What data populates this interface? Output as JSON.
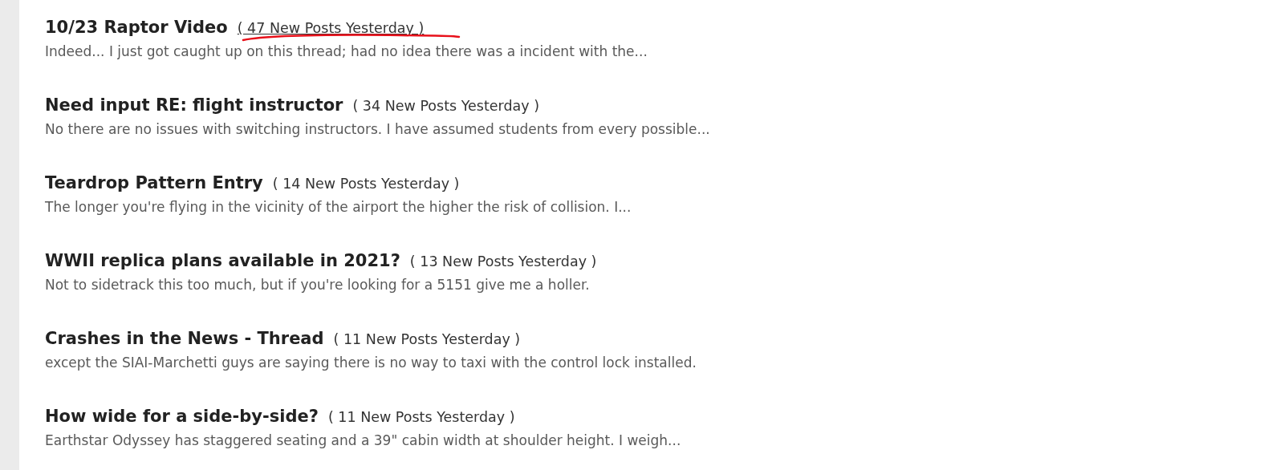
{
  "threads": [
    {
      "title": "10/23 Raptor Video",
      "count": "( 47 New Posts Yesterday )",
      "underlined": true,
      "annotated": true,
      "excerpt": "Indeed... I just got caught up on this thread; had no idea there was a incident with the..."
    },
    {
      "title": "Need input RE: flight instructor",
      "count": "( 34 New Posts Yesterday )",
      "underlined": false,
      "annotated": false,
      "excerpt": "No there are no issues with switching instructors. I have assumed students from every possible..."
    },
    {
      "title": "Teardrop Pattern Entry",
      "count": "( 14 New Posts Yesterday )",
      "underlined": false,
      "annotated": false,
      "excerpt": "The longer you're flying in the vicinity of the airport the higher the risk of collision. I..."
    },
    {
      "title": "WWII replica plans available in 2021?",
      "count": "( 13 New Posts Yesterday )",
      "underlined": false,
      "annotated": false,
      "excerpt": "Not to sidetrack this too much, but if you're looking for a 5151 give me a holler."
    },
    {
      "title": "Crashes in the News - Thread",
      "count": "( 11 New Posts Yesterday )",
      "underlined": false,
      "annotated": false,
      "excerpt": "except the SIAI-Marchetti guys are saying there is no way to taxi with the control lock installed."
    },
    {
      "title": "How wide for a side-by-side?",
      "count": "( 11 New Posts Yesterday )",
      "underlined": false,
      "annotated": false,
      "excerpt": "Earthstar Odyssey has staggered seating and a 39\" cabin width at shoulder height. I weigh..."
    }
  ]
}
